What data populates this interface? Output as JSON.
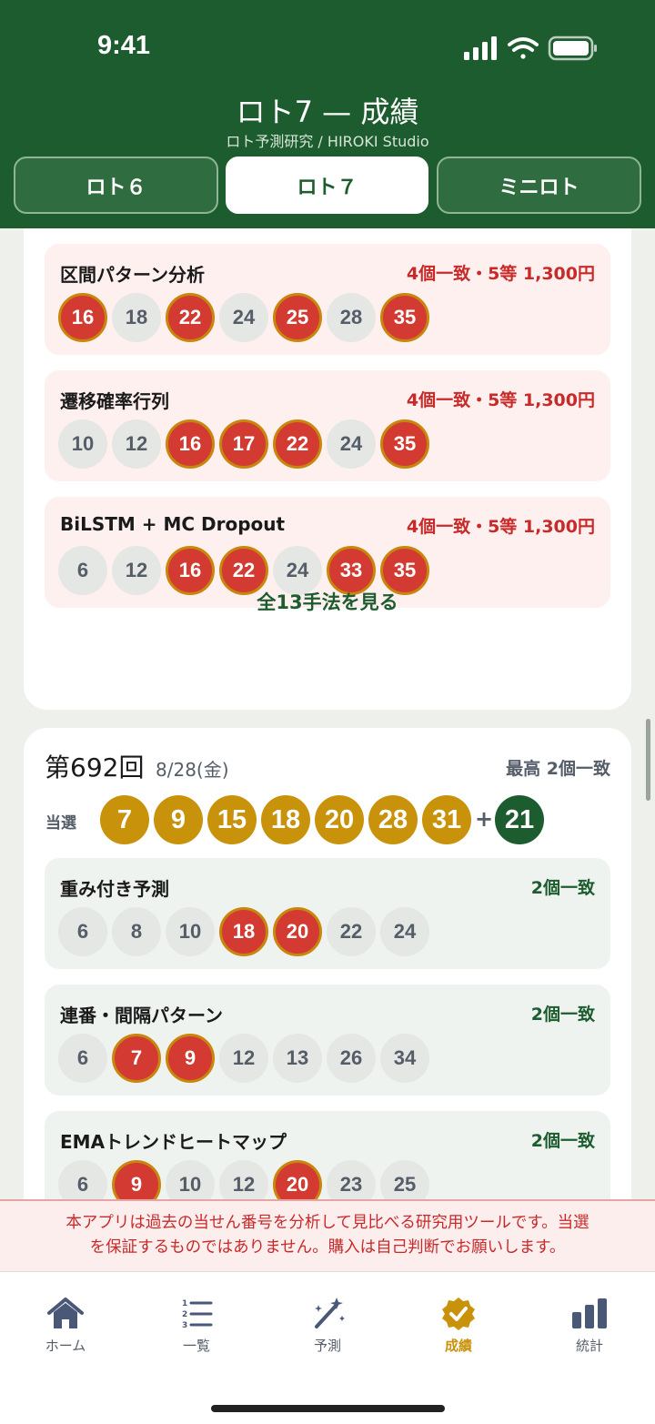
{
  "status": {
    "time": "9:41"
  },
  "header": {
    "title": "ロト7 — 成績",
    "subtitle": "ロト予測研究 / HIROKI Studio",
    "segments": [
      {
        "label": "ロト６",
        "active": false
      },
      {
        "label": "ロト７",
        "active": true
      },
      {
        "label": "ミニロト",
        "active": false
      }
    ]
  },
  "cards": [
    {
      "methods": [
        {
          "name": "区間パターン分析",
          "result": "4個一致・5等 1,300円",
          "numbers": [
            "16",
            "18",
            "22",
            "24",
            "25",
            "28",
            "35"
          ],
          "hits": [
            true,
            false,
            true,
            false,
            true,
            false,
            true
          ]
        },
        {
          "name": "遷移確率行列",
          "result": "4個一致・5等 1,300円",
          "numbers": [
            "10",
            "12",
            "16",
            "17",
            "22",
            "24",
            "35"
          ],
          "hits": [
            false,
            false,
            true,
            true,
            true,
            false,
            true
          ]
        },
        {
          "name": "BiLSTM + MC Dropout",
          "result": "4個一致・5等 1,300円",
          "numbers": [
            "6",
            "12",
            "16",
            "22",
            "24",
            "33",
            "35"
          ],
          "hits": [
            false,
            false,
            true,
            true,
            false,
            true,
            true
          ]
        }
      ],
      "see_all": "全13手法を見る"
    },
    {
      "draw_no": "第692回",
      "draw_date": "8/28(金)",
      "best_match": "最高 2個一致",
      "win_label": "当選",
      "winning_numbers": [
        "7",
        "9",
        "15",
        "18",
        "20",
        "28",
        "31"
      ],
      "plus": "+",
      "bonus_number": "21",
      "methods": [
        {
          "name": "重み付き予測",
          "result": "2個一致",
          "numbers": [
            "6",
            "8",
            "10",
            "18",
            "20",
            "22",
            "24"
          ],
          "hits": [
            false,
            false,
            false,
            true,
            true,
            false,
            false
          ]
        },
        {
          "name": "連番・間隔パターン",
          "result": "2個一致",
          "numbers": [
            "6",
            "7",
            "9",
            "12",
            "13",
            "26",
            "34"
          ],
          "hits": [
            false,
            true,
            true,
            false,
            false,
            false,
            false
          ]
        },
        {
          "name": "EMAトレンドヒートマップ",
          "result": "2個一致",
          "numbers": [
            "6",
            "9",
            "10",
            "12",
            "20",
            "23",
            "25"
          ],
          "hits": [
            false,
            true,
            false,
            false,
            true,
            false,
            false
          ]
        }
      ]
    }
  ],
  "disclaimer": {
    "line1": "本アプリは過去の当せん番号を分析して見比べる研究用ツールです。当選",
    "line2": "を保証するものではありません。購入は自己判断でお願いします。"
  },
  "tabs": [
    {
      "label": "ホーム",
      "icon": "home-icon",
      "active": false
    },
    {
      "label": "一覧",
      "icon": "list-icon",
      "active": false
    },
    {
      "label": "予測",
      "icon": "magic-wand-icon",
      "active": false
    },
    {
      "label": "成績",
      "icon": "badge-check-icon",
      "active": true
    },
    {
      "label": "統計",
      "icon": "bar-chart-icon",
      "active": false
    }
  ],
  "colors": {
    "brand_green": "#1d5c2e",
    "hit_red": "#d33a31",
    "gold": "#c8920a"
  }
}
